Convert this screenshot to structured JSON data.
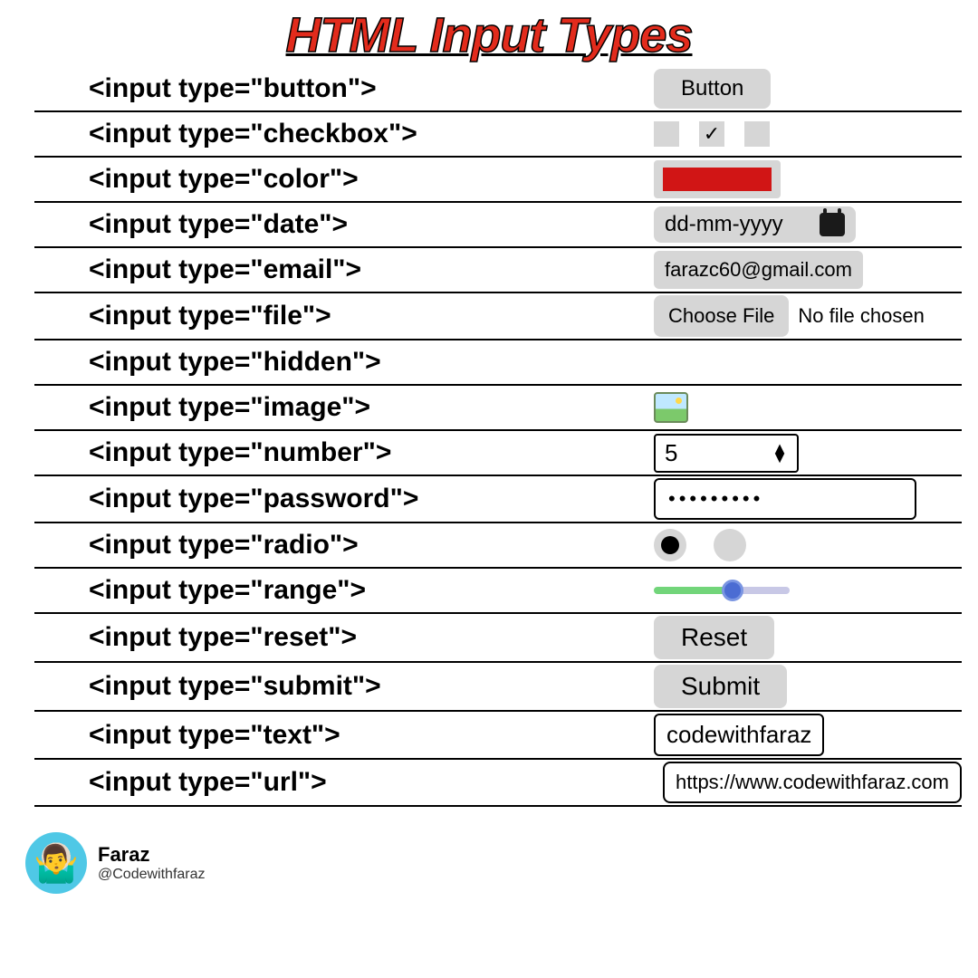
{
  "title": "HTML Input Types",
  "rows": {
    "button": {
      "code": "<input type=\"button\">",
      "label": "Button"
    },
    "checkbox": {
      "code": "<input type=\"checkbox\">",
      "states": [
        false,
        true,
        false
      ]
    },
    "color": {
      "code": "<input type=\"color\">",
      "value": "#d11515"
    },
    "date": {
      "code": "<input type=\"date\">",
      "placeholder": "dd-mm-yyyy"
    },
    "email": {
      "code": "<input type=\"email\">",
      "value": "farazc60@gmail.com"
    },
    "file": {
      "code": "<input type=\"file\">",
      "button": "Choose File",
      "status": "No file chosen"
    },
    "hidden": {
      "code": "<input type=\"hidden\">"
    },
    "image": {
      "code": "<input type=\"image\">"
    },
    "number": {
      "code": "<input type=\"number\">",
      "value": "5"
    },
    "password": {
      "code": "<input type=\"password\">",
      "mask": "•••••••••"
    },
    "radio": {
      "code": "<input type=\"radio\">",
      "states": [
        true,
        false
      ]
    },
    "range": {
      "code": "<input type=\"range\">",
      "percent": 60
    },
    "reset": {
      "code": "<input type=\"reset\">",
      "label": "Reset"
    },
    "submit": {
      "code": "<input type=\"submit\">",
      "label": "Submit"
    },
    "text": {
      "code": "<input type=\"text\">",
      "value": "codewithfaraz"
    },
    "url": {
      "code": "<input type=\"url\">",
      "value": "https://www.codewithfaraz.com"
    }
  },
  "footer": {
    "name": "Faraz",
    "handle": "@Codewithfaraz"
  }
}
